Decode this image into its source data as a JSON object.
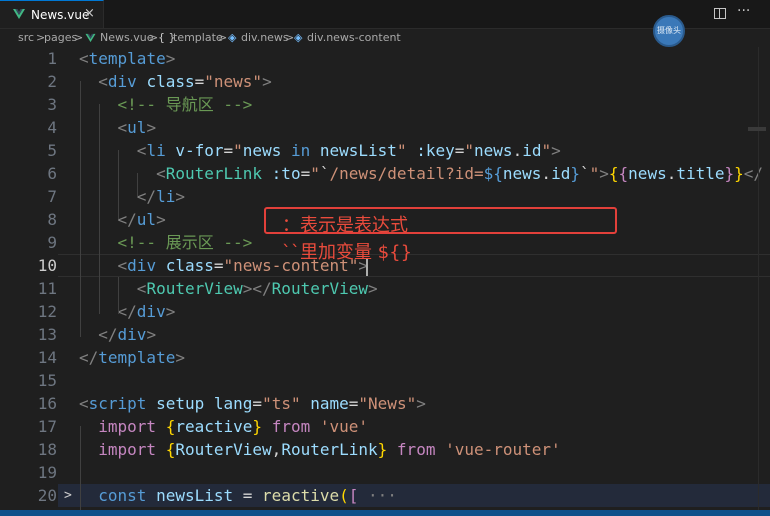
{
  "tab": {
    "label": "News.vue",
    "close": "×"
  },
  "toolbar": {
    "more": "···"
  },
  "breadcrumb": [
    "src",
    "pages",
    "News.vue",
    "template",
    "div.news",
    "div.news-content"
  ],
  "breadcrumb_sep": ">",
  "avatar_text": "摄像头",
  "lines": [
    [
      [
        "t-punct",
        "<"
      ],
      [
        "t-tag",
        "template"
      ],
      [
        "t-punct",
        ">"
      ]
    ],
    [
      [
        "t-txt",
        "  "
      ],
      [
        "t-punct",
        "<"
      ],
      [
        "t-tag",
        "div"
      ],
      [
        "t-txt",
        " "
      ],
      [
        "t-attr",
        "class"
      ],
      [
        "t-txt",
        "="
      ],
      [
        "t-str",
        "\"news\""
      ],
      [
        "t-punct",
        ">"
      ]
    ],
    [
      [
        "t-txt",
        "    "
      ],
      [
        "t-cmt",
        "<!-- 导航区 -->"
      ]
    ],
    [
      [
        "t-txt",
        "    "
      ],
      [
        "t-punct",
        "<"
      ],
      [
        "t-tag",
        "ul"
      ],
      [
        "t-punct",
        ">"
      ]
    ],
    [
      [
        "t-txt",
        "      "
      ],
      [
        "t-punct",
        "<"
      ],
      [
        "t-tag",
        "li"
      ],
      [
        "t-txt",
        " "
      ],
      [
        "t-attr",
        "v-for"
      ],
      [
        "t-txt",
        "="
      ],
      [
        "t-str",
        "\""
      ],
      [
        "t-attr",
        "news"
      ],
      [
        "t-txt",
        " "
      ],
      [
        "t-bl",
        "in"
      ],
      [
        "t-txt",
        " "
      ],
      [
        "t-attr",
        "newsList"
      ],
      [
        "t-str",
        "\""
      ],
      [
        "t-txt",
        " "
      ],
      [
        "t-attr",
        ":key"
      ],
      [
        "t-txt",
        "="
      ],
      [
        "t-str",
        "\""
      ],
      [
        "t-attr",
        "news"
      ],
      [
        "t-txt",
        "."
      ],
      [
        "t-attr",
        "id"
      ],
      [
        "t-str",
        "\""
      ],
      [
        "t-punct",
        ">"
      ]
    ],
    [
      [
        "t-txt",
        "        "
      ],
      [
        "t-punct",
        "<"
      ],
      [
        "t-comp",
        "RouterLink"
      ],
      [
        "t-txt",
        " "
      ],
      [
        "t-attr",
        ":to"
      ],
      [
        "t-txt",
        "="
      ],
      [
        "t-str",
        "\""
      ],
      [
        "t-txt",
        "`"
      ],
      [
        "t-str",
        "/news/detail?id="
      ],
      [
        "t-bl",
        "${"
      ],
      [
        "t-attr",
        "news"
      ],
      [
        "t-txt",
        "."
      ],
      [
        "t-attr",
        "id"
      ],
      [
        "t-bl",
        "}"
      ],
      [
        "t-txt",
        "`"
      ],
      [
        "t-str",
        "\""
      ],
      [
        "t-punct",
        ">"
      ],
      [
        "t-brace",
        "{"
      ],
      [
        "t-kw",
        "{"
      ],
      [
        "t-attr",
        "news"
      ],
      [
        "t-txt",
        "."
      ],
      [
        "t-attr",
        "title"
      ],
      [
        "t-kw",
        "}"
      ],
      [
        "t-brace",
        "}"
      ],
      [
        "t-punct",
        "</"
      ]
    ],
    [
      [
        "t-txt",
        "      "
      ],
      [
        "t-punct",
        "</"
      ],
      [
        "t-tag",
        "li"
      ],
      [
        "t-punct",
        ">"
      ]
    ],
    [
      [
        "t-txt",
        "    "
      ],
      [
        "t-punct",
        "</"
      ],
      [
        "t-tag",
        "ul"
      ],
      [
        "t-punct",
        ">"
      ]
    ],
    [
      [
        "t-txt",
        "    "
      ],
      [
        "t-cmt",
        "<!-- 展示区 -->"
      ]
    ],
    [
      [
        "t-txt",
        "    "
      ],
      [
        "t-punct",
        "<"
      ],
      [
        "t-tag",
        "div"
      ],
      [
        "t-txt",
        " "
      ],
      [
        "t-attr",
        "class"
      ],
      [
        "t-txt",
        "="
      ],
      [
        "t-str",
        "\"news-content\""
      ],
      [
        "t-punct",
        ">"
      ]
    ],
    [
      [
        "t-txt",
        "      "
      ],
      [
        "t-punct",
        "<"
      ],
      [
        "t-comp",
        "RouterView"
      ],
      [
        "t-punct",
        "></"
      ],
      [
        "t-comp",
        "RouterView"
      ],
      [
        "t-punct",
        ">"
      ]
    ],
    [
      [
        "t-txt",
        "    "
      ],
      [
        "t-punct",
        "</"
      ],
      [
        "t-tag",
        "div"
      ],
      [
        "t-punct",
        ">"
      ]
    ],
    [
      [
        "t-txt",
        "  "
      ],
      [
        "t-punct",
        "</"
      ],
      [
        "t-tag",
        "div"
      ],
      [
        "t-punct",
        ">"
      ]
    ],
    [
      [
        "t-punct",
        "</"
      ],
      [
        "t-tag",
        "template"
      ],
      [
        "t-punct",
        ">"
      ]
    ],
    [],
    [
      [
        "t-punct",
        "<"
      ],
      [
        "t-tag",
        "script"
      ],
      [
        "t-txt",
        " "
      ],
      [
        "t-attr",
        "setup"
      ],
      [
        "t-txt",
        " "
      ],
      [
        "t-attr",
        "lang"
      ],
      [
        "t-txt",
        "="
      ],
      [
        "t-str",
        "\"ts\""
      ],
      [
        "t-txt",
        " "
      ],
      [
        "t-attr",
        "name"
      ],
      [
        "t-txt",
        "="
      ],
      [
        "t-str",
        "\"News\""
      ],
      [
        "t-punct",
        ">"
      ]
    ],
    [
      [
        "t-txt",
        "  "
      ],
      [
        "t-kw",
        "import"
      ],
      [
        "t-txt",
        " "
      ],
      [
        "t-brace",
        "{"
      ],
      [
        "t-attr",
        "reactive"
      ],
      [
        "t-brace",
        "}"
      ],
      [
        "t-txt",
        " "
      ],
      [
        "t-kw",
        "from"
      ],
      [
        "t-txt",
        " "
      ],
      [
        "t-str",
        "'vue'"
      ]
    ],
    [
      [
        "t-txt",
        "  "
      ],
      [
        "t-kw",
        "import"
      ],
      [
        "t-txt",
        " "
      ],
      [
        "t-brace",
        "{"
      ],
      [
        "t-attr",
        "RouterView"
      ],
      [
        "t-txt",
        ","
      ],
      [
        "t-attr",
        "RouterLink"
      ],
      [
        "t-brace",
        "}"
      ],
      [
        "t-txt",
        " "
      ],
      [
        "t-kw",
        "from"
      ],
      [
        "t-txt",
        " "
      ],
      [
        "t-str",
        "'vue-router'"
      ]
    ],
    [],
    [
      [
        "t-txt",
        "  "
      ],
      [
        "t-bl",
        "const"
      ],
      [
        "t-txt",
        " "
      ],
      [
        "t-attr",
        "newsList"
      ],
      [
        "t-txt",
        " = "
      ],
      [
        "t-fn",
        "reactive"
      ],
      [
        "t-brace",
        "("
      ],
      [
        "t-kw",
        "["
      ],
      [
        "t-txt",
        " "
      ],
      [
        "t-punct",
        "···"
      ]
    ]
  ],
  "line_numbers": [
    "1",
    "2",
    "3",
    "4",
    "5",
    "6",
    "7",
    "8",
    "9",
    "10",
    "11",
    "12",
    "13",
    "14",
    "15",
    "16",
    "17",
    "18",
    "19",
    "20"
  ],
  "active_line": "10",
  "fold_marker": ">",
  "annotation": {
    "line1": "：表示是表达式",
    "line2": "``里加变量 ${}"
  }
}
